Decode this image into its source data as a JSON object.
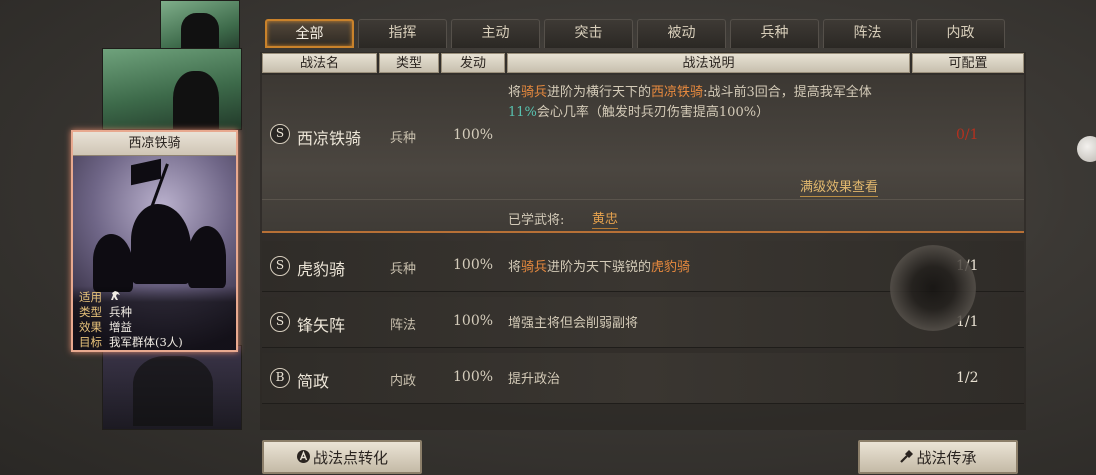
{
  "tabs": [
    "全部",
    "指挥",
    "主动",
    "突击",
    "被动",
    "兵种",
    "阵法",
    "内政"
  ],
  "active_tab": "全部",
  "headers": {
    "name": "战法名",
    "type": "类型",
    "rate": "发动",
    "desc": "战法说明",
    "count": "可配置"
  },
  "card": {
    "title": "西凉铁骑",
    "info": [
      {
        "key": "适用",
        "value": ""
      },
      {
        "key": "类型",
        "value": "兵种"
      },
      {
        "key": "效果",
        "value": "增益"
      },
      {
        "key": "目标",
        "value": "我军群体(3人)"
      }
    ],
    "applicable_icon": "horse-icon"
  },
  "skills": [
    {
      "grade": "S",
      "name": "西凉铁骑",
      "type": "兵种",
      "rate": "100%",
      "desc_parts": [
        {
          "t": "将"
        },
        {
          "t": "骑兵",
          "c": "hl"
        },
        {
          "t": "进阶为横行天下的"
        },
        {
          "t": "西凉铁骑",
          "c": "hl"
        },
        {
          "t": ":战斗前3回合，提高我军全体"
        },
        {
          "t": "11%",
          "c": "hl2"
        },
        {
          "t": "会心几率（触发时兵刃伤害提高100%）"
        }
      ],
      "count": "0/1",
      "full_effect": "满级效果查看",
      "learned_label": "已学武将:",
      "learned_name": "黄忠"
    },
    {
      "grade": "S",
      "name": "虎豹骑",
      "type": "兵种",
      "rate": "100%",
      "desc_parts": [
        {
          "t": "将"
        },
        {
          "t": "骑兵",
          "c": "hl"
        },
        {
          "t": "进阶为天下骁锐的"
        },
        {
          "t": "虎豹骑",
          "c": "hl"
        }
      ],
      "count": "1/1"
    },
    {
      "grade": "S",
      "name": "锋矢阵",
      "type": "阵法",
      "rate": "100%",
      "desc_parts": [
        {
          "t": "增强主将但会削弱副将"
        }
      ],
      "count": "1/1"
    },
    {
      "grade": "B",
      "name": "简政",
      "type": "内政",
      "rate": "100%",
      "desc_parts": [
        {
          "t": "提升政治"
        }
      ],
      "count": "1/2"
    }
  ],
  "buttons": {
    "convert": "战法点转化",
    "inherit": "战法传承"
  },
  "colors": {
    "accent_orange": "#c9822b",
    "highlight": "#e88a3e",
    "highlight_teal": "#58c2b0",
    "count_red": "#b5301f"
  }
}
